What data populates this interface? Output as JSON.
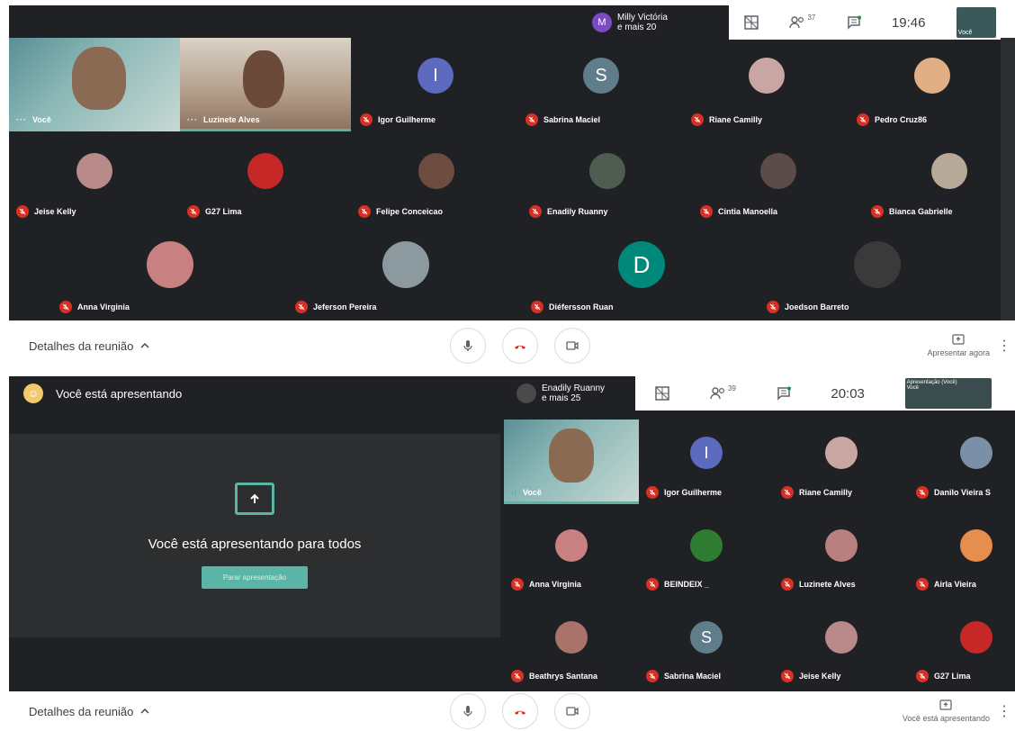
{
  "top_meeting": {
    "chat_preview": {
      "avatar_letter": "M",
      "line1": "Milly Victória",
      "line2": "e mais 20"
    },
    "participant_count": "37",
    "clock": "19:46",
    "self_thumb_label": "Você",
    "tiles": [
      {
        "name": "Você",
        "kind": "video"
      },
      {
        "name": "Luzinete Alves",
        "kind": "video"
      },
      {
        "name": "Igor Guilherme",
        "letter": "I",
        "color": "#5c6bc0"
      },
      {
        "name": "Sabrina Maciel",
        "letter": "S",
        "color": "#607d8b"
      },
      {
        "name": "Riane Camilly",
        "color": "#c9a6a3"
      },
      {
        "name": "Pedro Cruz86",
        "color": "#e0b084"
      },
      {
        "name": "Jeise Kelly",
        "color": "#b98a8a"
      },
      {
        "name": "G27 Lima",
        "color": "#c62828"
      },
      {
        "name": "Felipe Conceicao",
        "color": "#6d4c41"
      },
      {
        "name": "Enadily Ruanny",
        "color": "#4e5d50"
      },
      {
        "name": "Cintia Manoella",
        "color": "#5b4b49"
      },
      {
        "name": "Bianca Gabrielle",
        "color": "#b8a898"
      },
      {
        "name": "Anna Virginia",
        "color": "#c98080"
      },
      {
        "name": "Jeferson Pereira",
        "color": "#8c9aa0"
      },
      {
        "name": "Diéfersson Ruan",
        "letter": "D",
        "color": "#00897b"
      },
      {
        "name": "Joedson Barreto",
        "color": "#3a3a3a"
      }
    ]
  },
  "top_controls": {
    "details_label": "Detalhes da reunião",
    "present_label": "Apresentar agora",
    "more": "⋮"
  },
  "bottom_meeting": {
    "presenting_header": "Você está apresentando",
    "chat_preview": {
      "line1": "Enadily Ruanny",
      "line2": "e mais 25"
    },
    "participant_count": "39",
    "clock": "20:03",
    "self_thumb_label": "Apresentação (Você)",
    "self_thumb_label2": "Você",
    "present_card": {
      "headline": "Você está apresentando para todos",
      "stop_button": "Parar apresentação"
    },
    "tiles": [
      {
        "name": "Você",
        "kind": "video"
      },
      {
        "name": "Igor Guilherme",
        "letter": "I",
        "color": "#5c6bc0"
      },
      {
        "name": "Riane Camilly",
        "color": "#c9a6a3"
      },
      {
        "name": "Danilo Vieira S",
        "color": "#7b8fa6"
      },
      {
        "name": "Anna Virginia",
        "color": "#c98080"
      },
      {
        "name": "BEINDEIX _",
        "color": "#2e7d32"
      },
      {
        "name": "Luzinete Alves",
        "color": "#b98080"
      },
      {
        "name": "Airla Vieira",
        "color": "#e58e4e"
      },
      {
        "name": "Beathrys Santana",
        "color": "#a8736a"
      },
      {
        "name": "Sabrina Maciel",
        "letter": "S",
        "color": "#607d8b"
      },
      {
        "name": "Jeise Kelly",
        "color": "#b98a8a"
      },
      {
        "name": "G27 Lima",
        "color": "#c62828"
      }
    ]
  },
  "bottom_controls": {
    "details_label": "Detalhes da reunião",
    "present_label": "Você está apresentando",
    "more": "⋮"
  }
}
